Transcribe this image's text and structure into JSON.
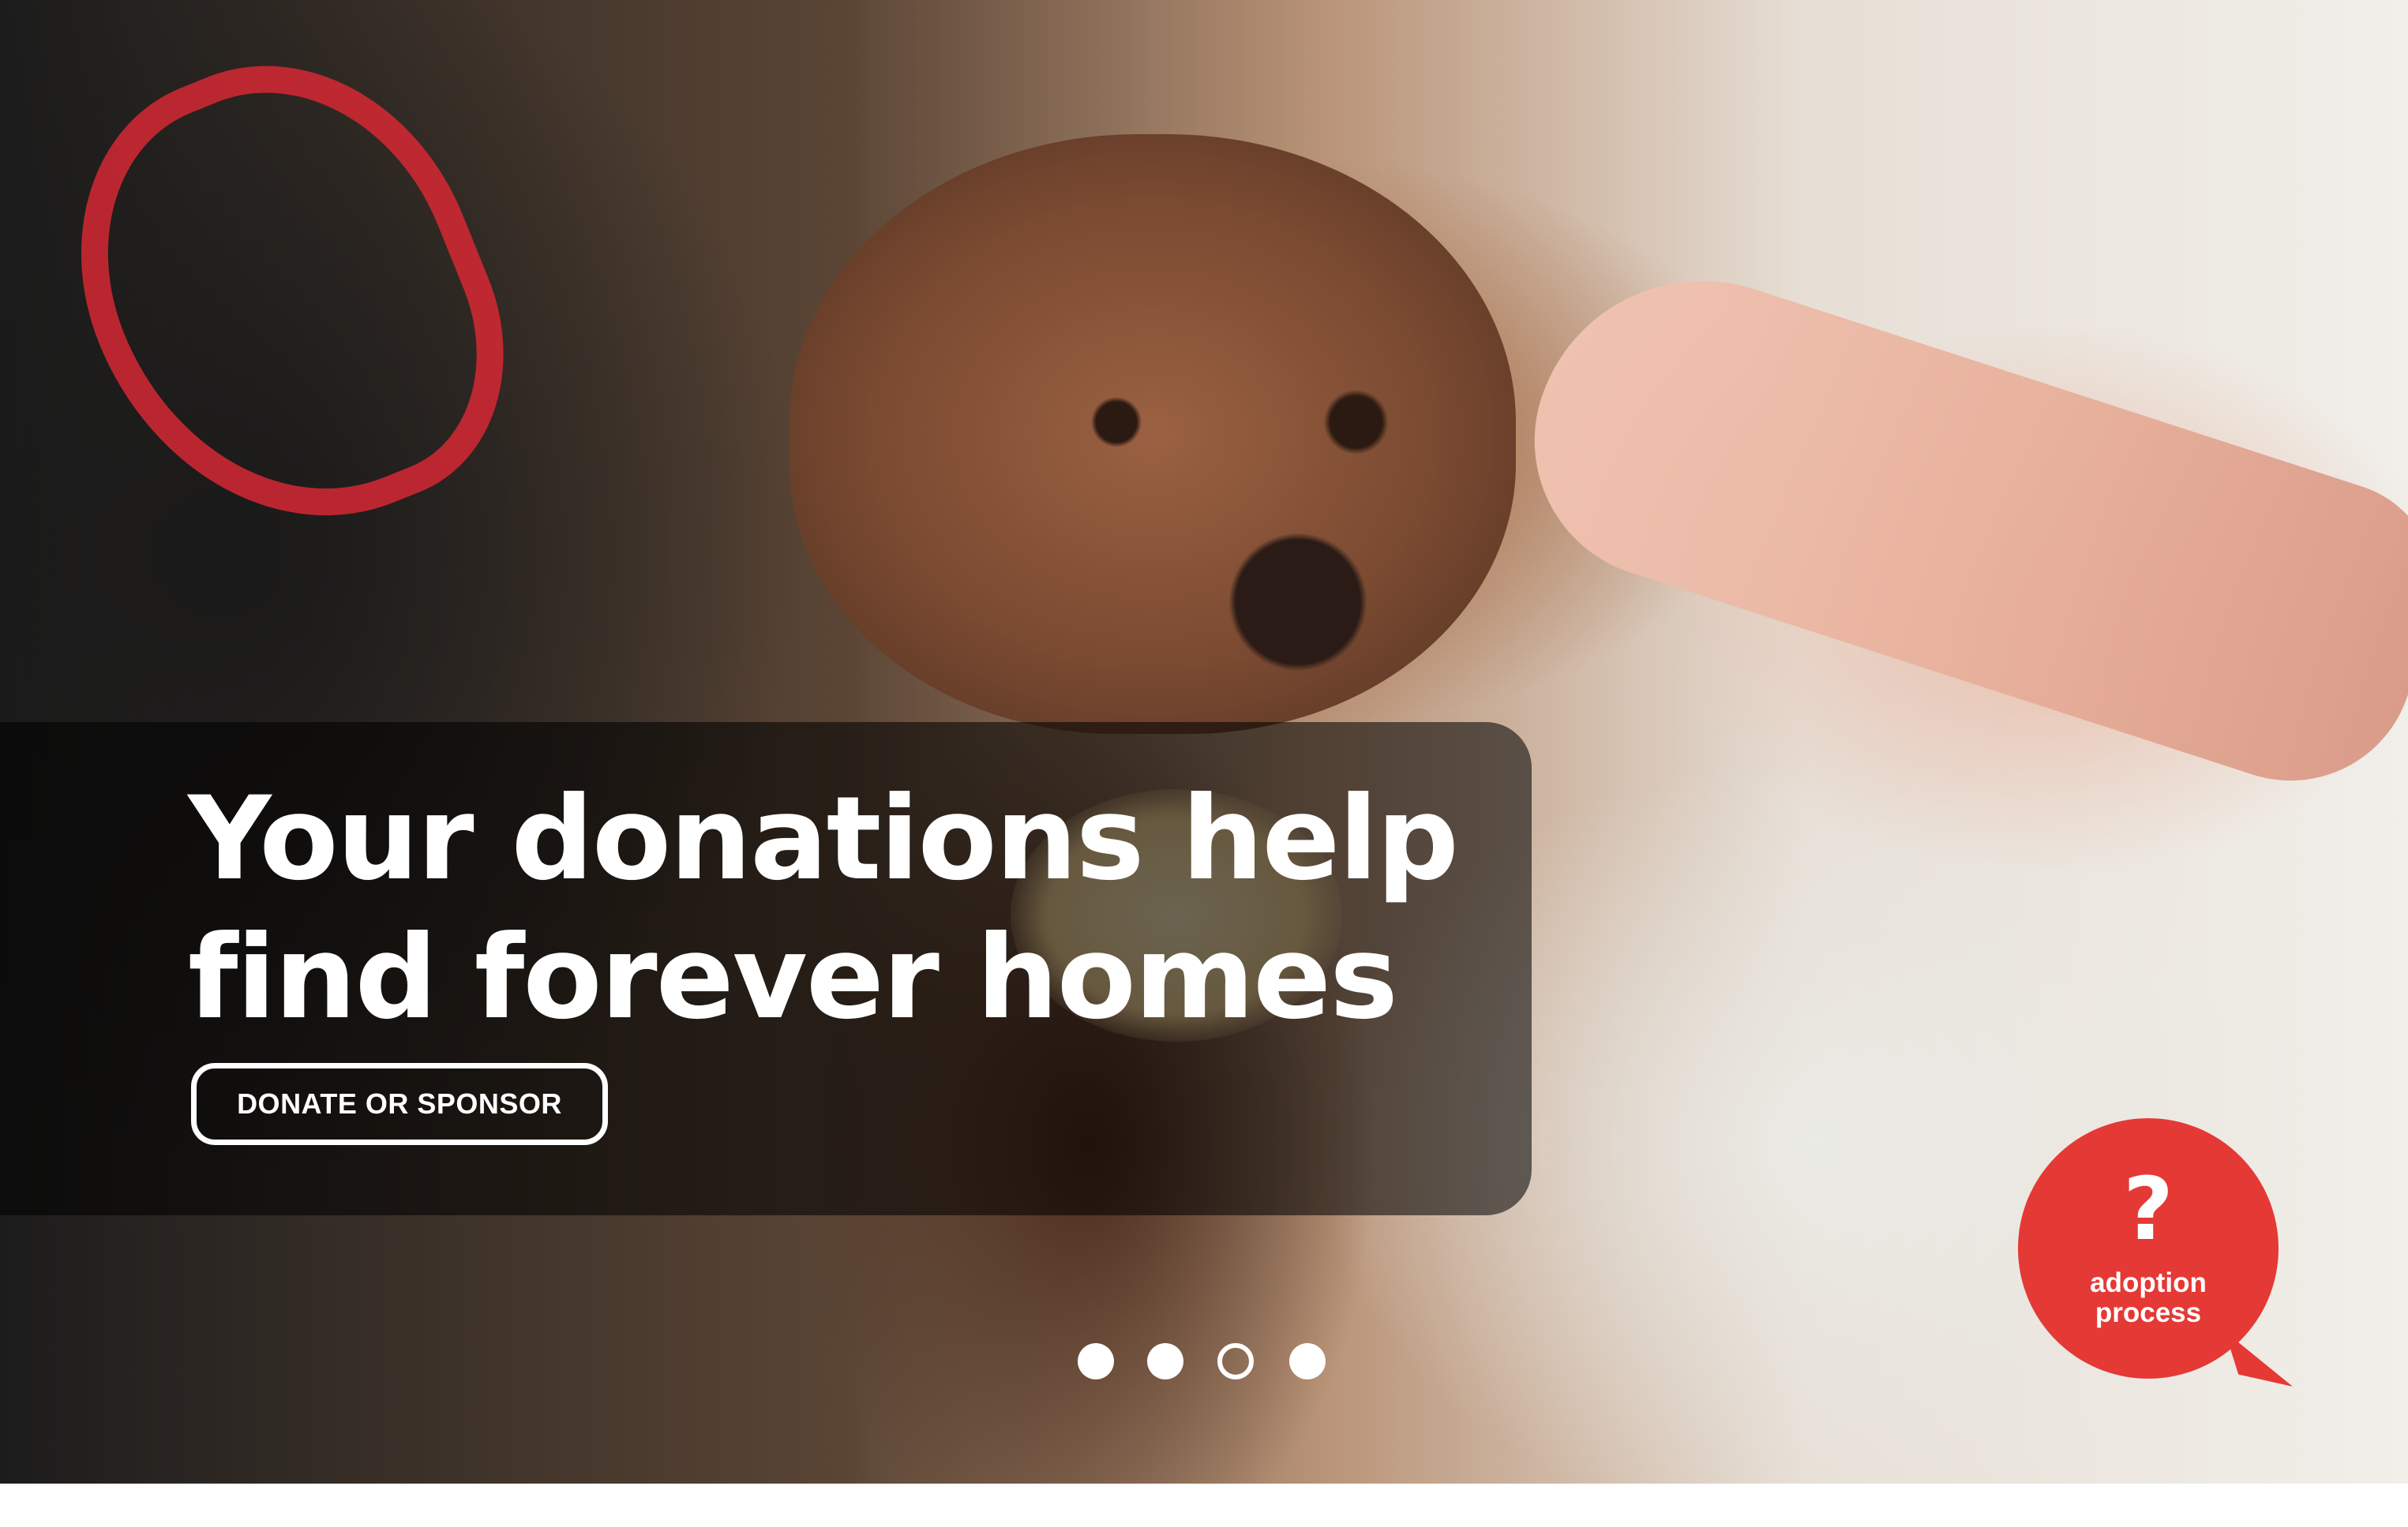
{
  "hero": {
    "headline": {
      "line_1": "Your donations help",
      "line_2": "find forever homes"
    },
    "cta_label": "DONATE OR SPONSOR"
  },
  "carousel": {
    "slide_count": 4,
    "active_index": 2
  },
  "adoption_badge": {
    "icon": "question-mark-icon",
    "symbol": "?",
    "label_line_1": "adoption",
    "label_line_2": "process",
    "color": "#e53935"
  },
  "colors": {
    "overlay": "rgba(0,0,0,0.56)",
    "text": "#ffffff",
    "accent": "#e53935"
  }
}
